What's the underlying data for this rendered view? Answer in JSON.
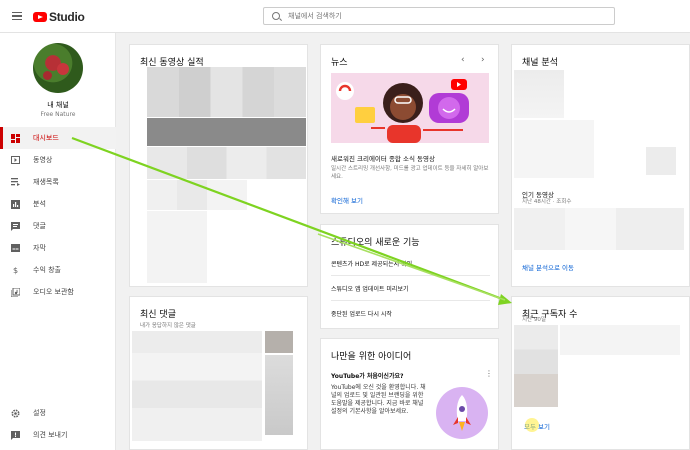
{
  "topbar": {
    "logo_text": "Studio",
    "search_placeholder": "채널에서 검색하기"
  },
  "sidebar": {
    "channel_label": "내 채널",
    "channel_name": "Free Nature",
    "items": [
      {
        "label": "대시보드",
        "icon": "dashboard-icon",
        "active": true
      },
      {
        "label": "동영상",
        "icon": "video-icon"
      },
      {
        "label": "재생목록",
        "icon": "playlist-icon"
      },
      {
        "label": "분석",
        "icon": "analytics-icon"
      },
      {
        "label": "댓글",
        "icon": "comment-icon"
      },
      {
        "label": "자막",
        "icon": "subtitles-icon"
      },
      {
        "label": "수익 창출",
        "icon": "dollar-icon"
      },
      {
        "label": "오디오 보관함",
        "icon": "audio-library-icon"
      }
    ],
    "bottom_items": [
      {
        "label": "설정",
        "icon": "gear-icon"
      },
      {
        "label": "의견 보내기",
        "icon": "feedback-icon"
      }
    ]
  },
  "cards": {
    "recent_video": {
      "title": "최신 동영상 실적"
    },
    "recent_comments": {
      "title": "최신 댓글",
      "subtitle": "내가 응답하지 않은 댓글"
    },
    "news": {
      "title": "뉴스",
      "headline": "새로워진 크리에이터 종합 소식 동영상",
      "body": "일시간 스트리밍 개선사항, 미드롤 광고 업데이트 등을 자세히 알아보세요.",
      "link": "확인해 보기"
    },
    "whats_new": {
      "title": "스튜디오의 새로운 기능",
      "items": [
        "콘텐츠가 HD로 제공되는지 확인",
        "스튜디오 앱 업데이트 미리보기",
        "중단된 업로드 다시 시작"
      ]
    },
    "ideas": {
      "title": "나만을 위한 아이디어",
      "question": "YouTube가 처음이신가요?",
      "body": "YouTube에 오신 것을 환영합니다. 채널의 업로드 및 일관된 브랜딩을 위한 도움말을 제공합니다. 지금 바로 채널 설정의 기본사항을 알아보세요."
    },
    "analytics": {
      "title": "채널 분석",
      "popular_title": "인기 동영상",
      "popular_sub": "지난 48시간 · 조회수",
      "link": "채널 분석으로 이동"
    },
    "subscribers": {
      "title": "최근 구독자 수",
      "subtitle": "지난 90일",
      "link": "모두 보기"
    }
  },
  "colors": {
    "accent_red": "#cc0000",
    "link_blue": "#065fd4",
    "annotation_green": "#7ed321"
  }
}
